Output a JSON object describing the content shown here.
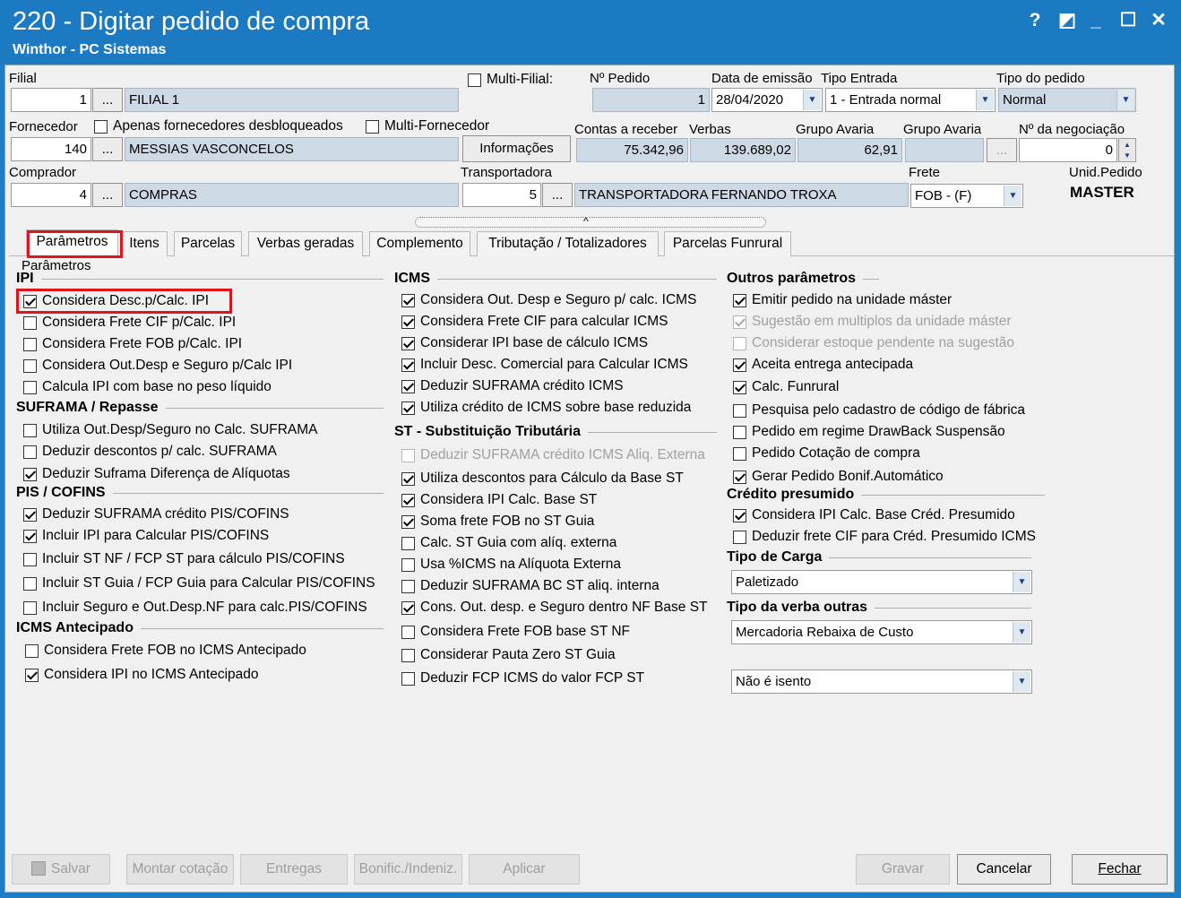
{
  "window": {
    "title": "220 - Digitar pedido de compra",
    "subtitle": "Winthor - PC Sistemas",
    "help": "?",
    "restore": "◩",
    "minimize": "_",
    "maximize": "☐",
    "close": "✕"
  },
  "header": {
    "filial_label": "Filial",
    "filial_code": "1",
    "filial_name": "FILIAL 1",
    "ellipsis": "...",
    "multi_filial": "Multi-Filial:",
    "npedido_label": "Nº Pedido",
    "npedido_value": "1",
    "data_emissao_label": "Data de emissão",
    "data_emissao_value": "28/04/2020",
    "tipo_entrada_label": "Tipo Entrada",
    "tipo_entrada_value": "1 - Entrada normal",
    "tipo_pedido_label": "Tipo do pedido",
    "tipo_pedido_value": "Normal",
    "fornecedor_label": "Fornecedor",
    "apenas_desbloq": "Apenas fornecedores desbloqueados",
    "multi_fornecedor": "Multi-Fornecedor",
    "fornecedor_code": "140",
    "fornecedor_name": "MESSIAS VASCONCELOS",
    "informacoes": "Informações",
    "contas_label": "Contas a receber",
    "contas_value": "75.342,96",
    "verbas_label": "Verbas",
    "verbas_value": "139.689,02",
    "grupo_avaria1_label": "Grupo Avaria",
    "grupo_avaria1_value": "62,91",
    "grupo_avaria2_label": "Grupo Avaria",
    "grupo_avaria2_value": "",
    "negociacao_label": "Nº da negociação",
    "negociacao_value": "0",
    "comprador_label": "Comprador",
    "comprador_code": "4",
    "comprador_name": "COMPRAS",
    "transportadora_label": "Transportadora",
    "transportadora_code": "5",
    "transportadora_name": "TRANSPORTADORA FERNANDO TROXA",
    "frete_label": "Frete",
    "frete_value": "FOB - (F)",
    "unid_label": "Unid.Pedido",
    "unid_value": "MASTER"
  },
  "tabs": [
    "Parâmetros",
    "Itens",
    "Parcelas",
    "Verbas geradas",
    "Complemento",
    "Tributação / Totalizadores",
    "Parcelas Funrural"
  ],
  "group_title": "Parâmetros",
  "col1": {
    "ipi_title": "IPI",
    "ipi": [
      {
        "label": "Considera Desc.p/Calc. IPI",
        "checked": true
      },
      {
        "label": "Considera Frete CIF p/Calc. IPI",
        "checked": false
      },
      {
        "label": "Considera Frete FOB p/Calc. IPI",
        "checked": false
      },
      {
        "label": "Considera Out.Desp e Seguro p/Calc IPI",
        "checked": false
      },
      {
        "label": "Calcula IPI com base no peso líquido",
        "checked": false
      }
    ],
    "suframa_title": "SUFRAMA / Repasse",
    "suframa": [
      {
        "label": "Utiliza Out.Desp/Seguro no Calc. SUFRAMA",
        "checked": false
      },
      {
        "label": "Deduzir descontos p/ calc. SUFRAMA",
        "checked": false
      },
      {
        "label": "Deduzir Suframa Diferença de Alíquotas",
        "checked": true
      }
    ],
    "pis_title": "PIS / COFINS",
    "pis": [
      {
        "label": "Deduzir SUFRAMA crédito PIS/COFINS",
        "checked": true
      },
      {
        "label": "Incluir IPI para Calcular PIS/COFINS",
        "checked": true
      },
      {
        "label": "Incluir ST NF / FCP ST para cálculo PIS/COFINS",
        "checked": false
      },
      {
        "label": "Incluir ST Guia / FCP Guia para Calcular PIS/COFINS",
        "checked": false
      },
      {
        "label": "Incluir Seguro e Out.Desp.NF para calc.PIS/COFINS",
        "checked": false
      }
    ],
    "icmsant_title": "ICMS Antecipado",
    "icmsant": [
      {
        "label": "Considera Frete FOB no ICMS Antecipado",
        "checked": false
      },
      {
        "label": "Considera IPI no ICMS Antecipado",
        "checked": true
      }
    ]
  },
  "col2": {
    "icms_title": "ICMS",
    "icms": [
      {
        "label": "Considera Out. Desp e Seguro p/ calc. ICMS",
        "checked": true
      },
      {
        "label": "Considera Frete CIF para calcular ICMS",
        "checked": true
      },
      {
        "label": "Considerar IPI base de cálculo ICMS",
        "checked": true
      },
      {
        "label": "Incluir Desc. Comercial  para Calcular ICMS",
        "checked": true
      },
      {
        "label": "Deduzir SUFRAMA crédito ICMS",
        "checked": true
      },
      {
        "label": "Utiliza crédito de ICMS sobre base reduzida",
        "checked": true
      }
    ],
    "st_title": "ST - Substituição Tributária",
    "st": [
      {
        "label": "Deduzir SUFRAMA crédito ICMS Aliq. Externa",
        "checked": false,
        "disabled": true
      },
      {
        "label": "Utiliza descontos para Cálculo da Base ST",
        "checked": true
      },
      {
        "label": "Considera IPI Calc. Base ST",
        "checked": true
      },
      {
        "label": "Soma frete FOB no ST Guia",
        "checked": true
      },
      {
        "label": "Calc. ST Guia com alíq. externa",
        "checked": false
      },
      {
        "label": "Usa %ICMS na Alíquota Externa",
        "checked": false
      },
      {
        "label": "Deduzir SUFRAMA BC ST aliq. interna",
        "checked": false
      },
      {
        "label": "Cons. Out. desp. e Seguro dentro NF Base ST",
        "checked": true
      },
      {
        "label": "Considera Frete FOB base ST NF",
        "checked": false
      },
      {
        "label": "Considerar Pauta Zero ST Guia",
        "checked": false
      },
      {
        "label": "Deduzir FCP ICMS do valor FCP ST",
        "checked": false
      }
    ]
  },
  "col3": {
    "outros_title": "Outros parâmetros",
    "outros": [
      {
        "label": "Emitir pedido na unidade máster",
        "checked": true
      },
      {
        "label": "Sugestão em multiplos da unidade máster",
        "checked": true,
        "disabled": true
      },
      {
        "label": "Considerar estoque pendente na sugestão",
        "checked": false,
        "disabled": true
      },
      {
        "label": "Aceita entrega antecipada",
        "checked": true
      },
      {
        "label": "Calc. Funrural",
        "checked": true
      },
      {
        "label": "Pesquisa pelo cadastro de código de fábrica",
        "checked": false
      },
      {
        "label": "Pedido em regime DrawBack Suspensão",
        "checked": false
      },
      {
        "label": "Pedido Cotação de compra",
        "checked": false
      },
      {
        "label": "Gerar Pedido Bonif.Automático",
        "checked": true
      }
    ],
    "credito_title": "Crédito presumido",
    "credito": [
      {
        "label": "Considera IPI Calc. Base Créd. Presumido",
        "checked": true
      },
      {
        "label": "Deduzir frete CIF para Créd. Presumido ICMS",
        "checked": false
      }
    ],
    "carga_title": "Tipo de Carga",
    "carga_value": "Paletizado",
    "verba_title": "Tipo da verba outras",
    "verba_value": "Mercadoria Rebaixa de Custo",
    "isento_value": "Não é isento"
  },
  "footer": {
    "salvar": "Salvar",
    "montar": "Montar cotação",
    "entregas": "Entregas",
    "bonific": "Bonific./Indeniz.",
    "aplicar": "Aplicar",
    "gravar": "Gravar",
    "cancelar": "Cancelar",
    "fechar": "Fechar"
  }
}
